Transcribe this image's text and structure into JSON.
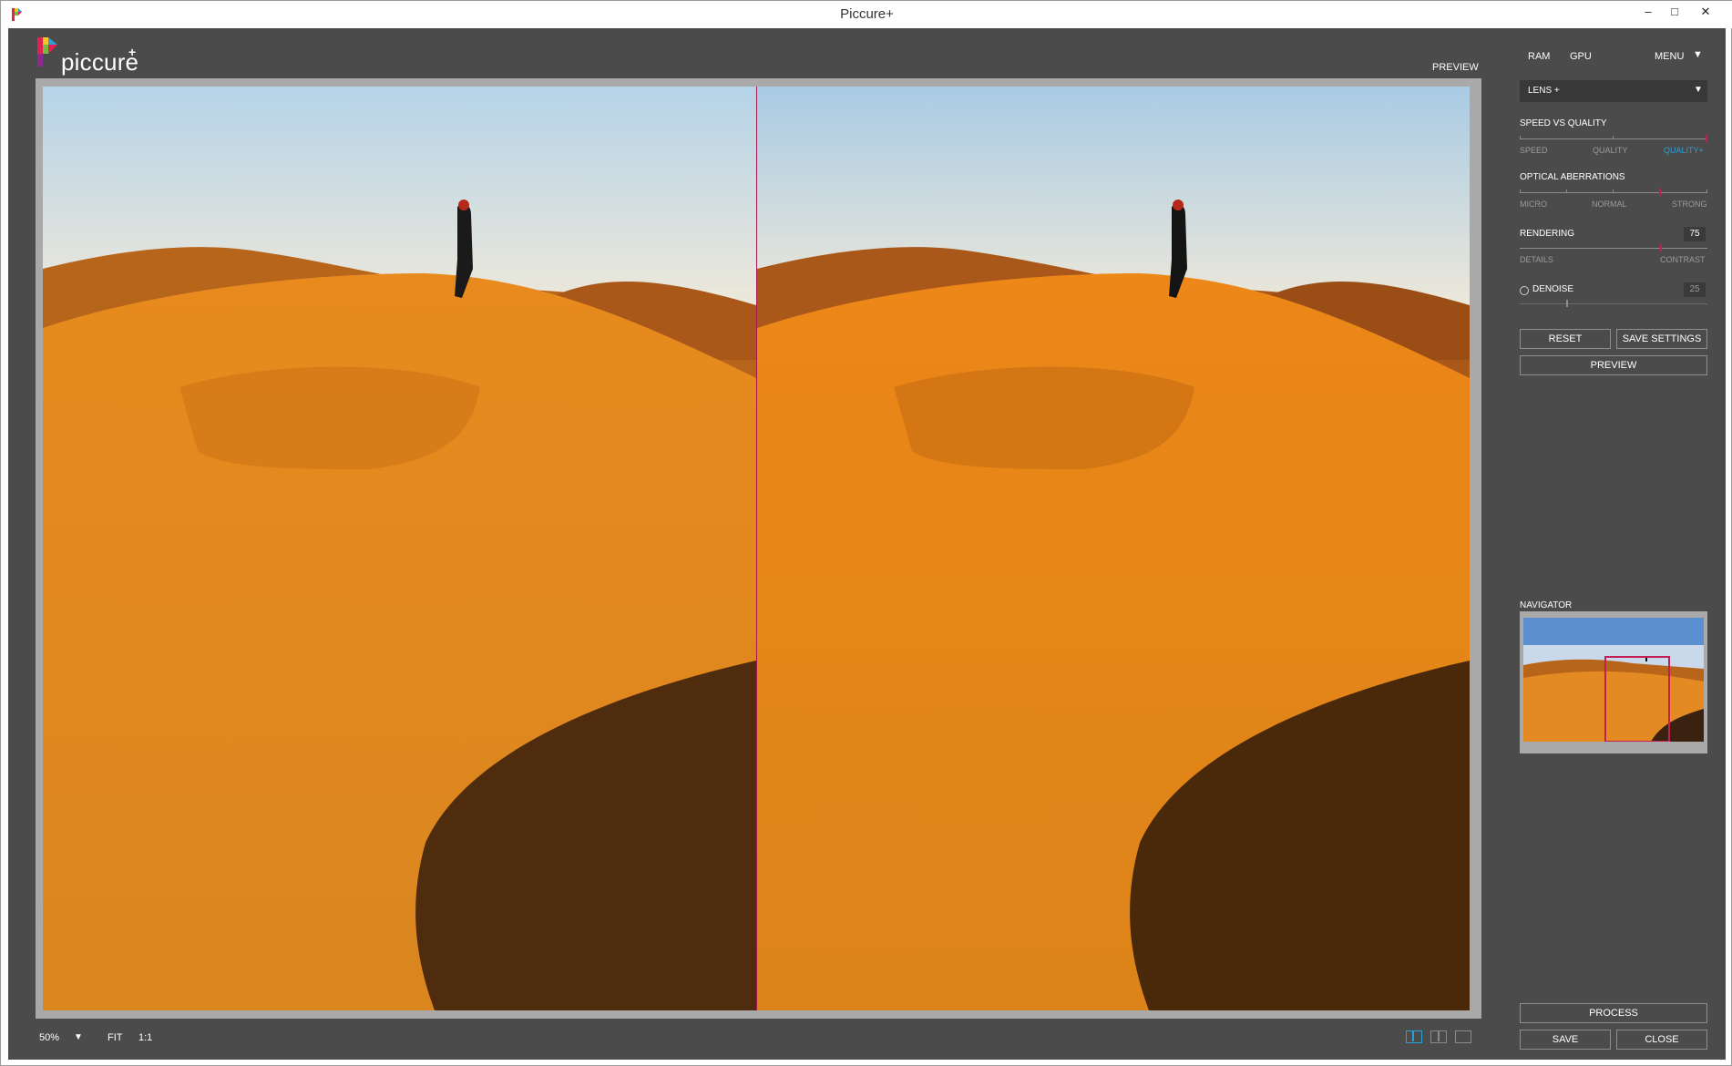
{
  "window": {
    "title": "Piccure+"
  },
  "logo": {
    "text": "piccure",
    "plus": "+"
  },
  "canvas": {
    "mode_label": "PREVIEW"
  },
  "bottom_toolbar": {
    "zoom": "50%",
    "fit": "FIT",
    "one_to_one": "1:1"
  },
  "panel": {
    "top_items": [
      "RAM",
      "GPU",
      "MENU"
    ],
    "preset": "LENS +",
    "speed_vs_quality": {
      "label": "SPEED VS QUALITY",
      "ticks": [
        "SPEED",
        "QUALITY",
        "QUALITY+"
      ],
      "selected": "QUALITY+"
    },
    "optical_aberrations": {
      "label": "OPTICAL ABERRATIONS",
      "ticks": [
        "MICRO",
        "NORMAL",
        "STRONG"
      ],
      "value_fraction": 0.75
    },
    "rendering": {
      "label": "RENDERING",
      "value": "75",
      "ticks": [
        "DETAILS",
        "CONTRAST"
      ],
      "value_fraction": 0.75
    },
    "denoise": {
      "label": "DENOISE",
      "value": "25",
      "value_fraction": 0.25,
      "enabled": false
    },
    "buttons": {
      "reset": "RESET",
      "save_settings": "SAVE SETTINGS",
      "preview": "PREVIEW",
      "process": "PROCESS",
      "save": "SAVE",
      "close": "CLOSE"
    },
    "navigator_label": "NAVIGATOR"
  },
  "colors": {
    "accent": "#c31f56",
    "quality_selected": "#2a9fd8",
    "app_bg": "#4b4b4b"
  }
}
